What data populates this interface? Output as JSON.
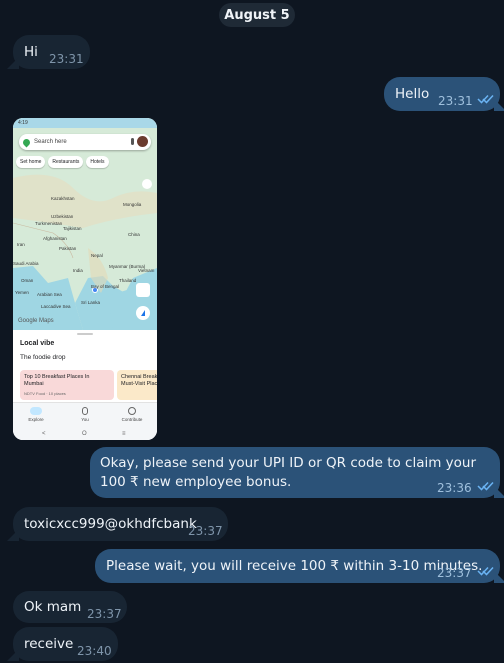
{
  "date_separator": "August 5",
  "messages": [
    {
      "text": "Hi",
      "time": "23:31"
    },
    {
      "text": "Hello",
      "time": "23:31"
    },
    {
      "text": "Okay, please send your UPI ID or QR code to claim your 100 ₹ new employee bonus.",
      "time": "23:36"
    },
    {
      "text": "toxicxcc999@okhdfcbank",
      "time": "23:37"
    },
    {
      "text": "Please wait, you will receive 100 ₹ within 3-10 minutes.",
      "time": "23:37"
    },
    {
      "text": "Ok mam",
      "time": "23:37"
    },
    {
      "text": "receive",
      "time": "23:40"
    }
  ],
  "screenshot": {
    "status_time": "4:19",
    "search_placeholder": "Search here",
    "chips": [
      "Set home",
      "Restaurants",
      "Hotels"
    ],
    "map_labels": [
      "Kazakhstan",
      "Mongolia",
      "Uzbekistan",
      "Turkmenistan",
      "Tajikistan",
      "Afghanistan",
      "China",
      "Iran",
      "Pakistan",
      "Nepal",
      "Saudi Arabia",
      "Oman",
      "India",
      "Myanmar (Burma)",
      "Thailand",
      "Vietnam",
      "Arabian Sea",
      "Bay of Bengal",
      "Sri Lanka",
      "Laccadive Sea",
      "Yemen"
    ],
    "maps_brand": "Google Maps",
    "sheet_title": "Local vibe",
    "sheet_subtitle": "The foodie drop",
    "cards": [
      {
        "title": "Top 10 Breakfast Places In Mumbai",
        "source": "NDTV Food · 10 places"
      },
      {
        "title": "Chennai Breakfast Must-Visit Places",
        "source": ""
      }
    ],
    "nav": [
      "Explore",
      "You",
      "Contribute"
    ],
    "sysnav": [
      "<",
      "O",
      "≡"
    ]
  },
  "colors": {
    "background": "#0e1621",
    "incoming_bubble": "#182533",
    "outgoing_bubble": "#2b5278",
    "read_ticks": "#6ab3f3"
  }
}
